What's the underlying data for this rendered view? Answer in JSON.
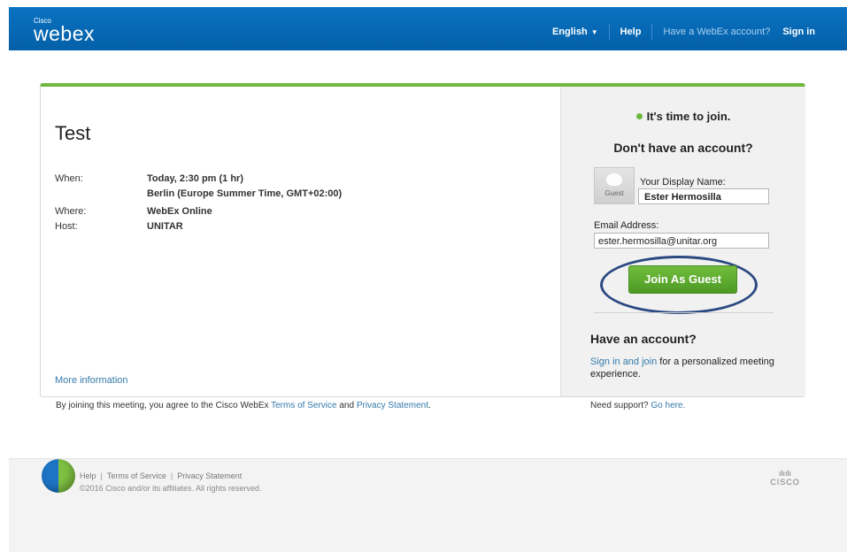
{
  "header": {
    "logo_small": "Cisco",
    "logo_main": "webex",
    "language": "English",
    "help": "Help",
    "have_account": "Have a WebEx account?",
    "sign_in": "Sign in"
  },
  "meeting": {
    "title": "Test",
    "when_label": "When:",
    "when_value": "Today, 2:30 pm  (1 hr)",
    "timezone": "Berlin (Europe Summer Time, GMT+02:00)",
    "where_label": "Where:",
    "where_value": "WebEx Online",
    "host_label": "Host:",
    "host_value": "UNITAR",
    "more_info": "More information"
  },
  "join_panel": {
    "time_to_join": "It's time to join.",
    "no_account_heading": "Don't have an account?",
    "avatar_label": "Guest",
    "display_name_label": "Your Display Name:",
    "display_name_value": "Ester Hermosilla",
    "email_label": "Email Address:",
    "email_value": "ester.hermosilla@unitar.org",
    "join_button": "Join As Guest",
    "have_account_heading": "Have an account?",
    "signin_link": "Sign in and join",
    "signin_rest": " for a personalized meeting experience."
  },
  "agreement": {
    "prefix": "By joining this meeting, you agree to the Cisco WebEx ",
    "terms_link": "Terms of Service",
    "middle": " and ",
    "privacy_link": "Privacy Statement",
    "suffix": "."
  },
  "support": {
    "prefix": "Need support? ",
    "link": "Go here."
  },
  "footer": {
    "help": "Help",
    "terms": "Terms of Service",
    "privacy": "Privacy Statement",
    "copyright": "©2016 Cisco and/or its affiliates. All rights reserved.",
    "cisco_bars": "ılıılı",
    "cisco_word": "CISCO"
  },
  "colors": {
    "topbar": "#0a72c2",
    "accent_green": "#6fb83e",
    "link_blue": "#3479a9",
    "ring": "#2c4a82"
  }
}
